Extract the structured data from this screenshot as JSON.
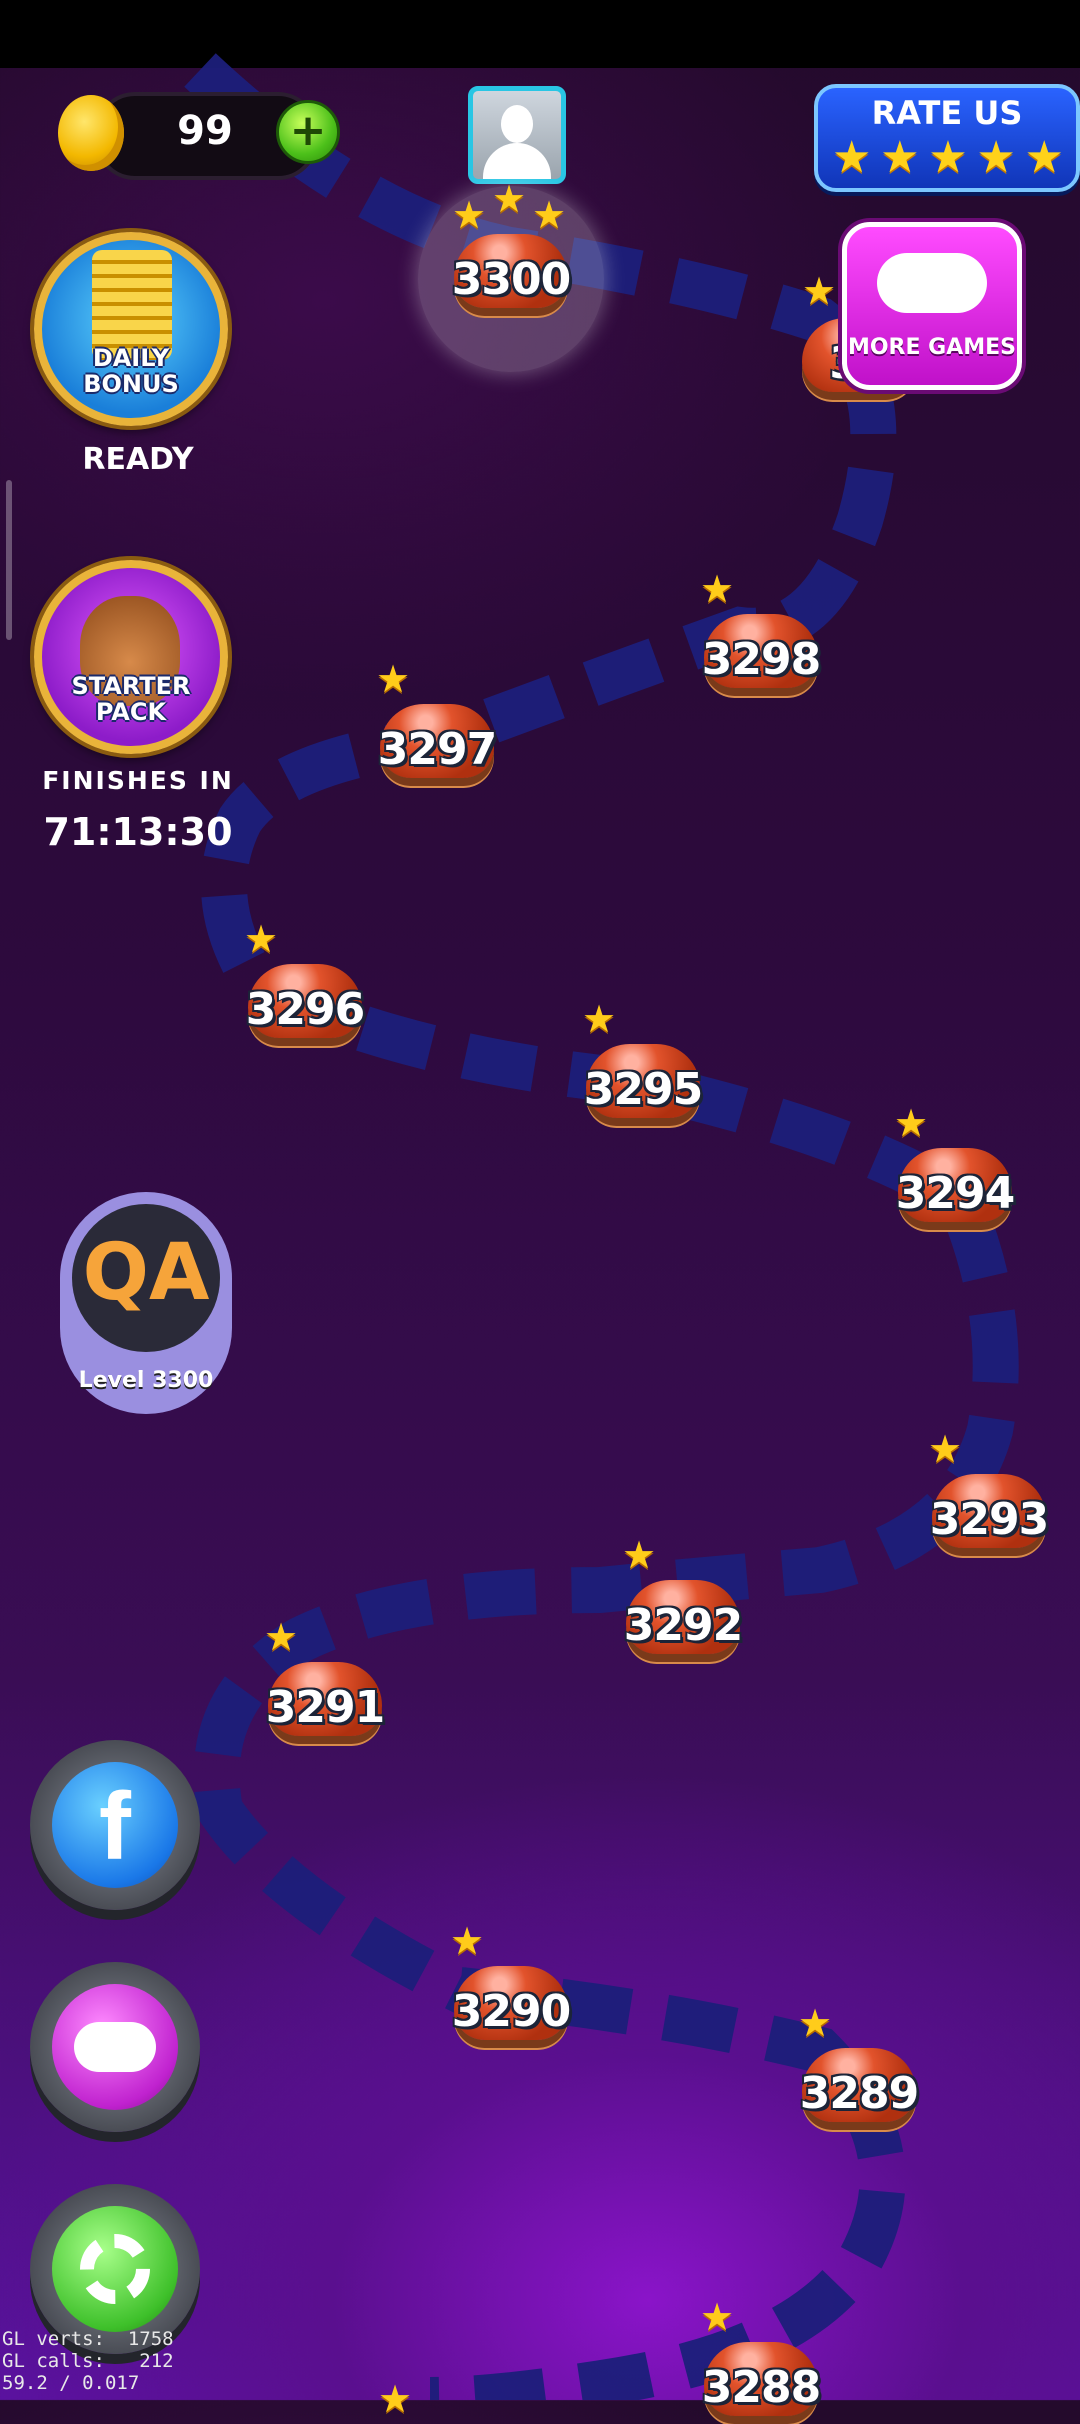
{
  "header": {
    "coins": "99",
    "coin_plus": "+",
    "rate_us_label": "RATE US",
    "rate_us_stars": 5
  },
  "left_panel": {
    "daily_bonus_label_1": "DAILY",
    "daily_bonus_label_2": "BONUS",
    "daily_bonus_status": "READY",
    "starter_pack_label_1": "STARTER",
    "starter_pack_label_2": "PACK",
    "starter_pack_caption": "FINISHES IN",
    "starter_pack_timer": "71:13:30"
  },
  "more_games": {
    "label": "MORE GAMES"
  },
  "qa_badge": {
    "text": "QA",
    "level_label": "Level 3300"
  },
  "levels": [
    {
      "number": "3300",
      "stars": 3,
      "current": true
    },
    {
      "number": "3299",
      "visible_text": "32",
      "stars": 1
    },
    {
      "number": "3298",
      "stars": 1
    },
    {
      "number": "3297",
      "stars": 1
    },
    {
      "number": "3296",
      "stars": 1
    },
    {
      "number": "3295",
      "stars": 1
    },
    {
      "number": "3294",
      "stars": 1
    },
    {
      "number": "3293",
      "stars": 1
    },
    {
      "number": "3292",
      "stars": 1
    },
    {
      "number": "3291",
      "stars": 1
    },
    {
      "number": "3290",
      "stars": 1
    },
    {
      "number": "3289",
      "stars": 1
    },
    {
      "number": "3288",
      "stars": 1
    }
  ],
  "bottom_buttons": {
    "facebook_letter": "f",
    "icons": [
      "facebook-icon",
      "gamepad-icon",
      "settings-gear-icon"
    ]
  },
  "debug": {
    "line1": "GL verts:  1758",
    "line2": "GL calls:   212",
    "line3": "59.2 / 0.017"
  },
  "colors": {
    "path": "#1c1f7a",
    "level_dome": "#e2532c",
    "star": "#ffcc1a",
    "rate_us_bg": "#1f4be0",
    "more_games_bg": "#e02ee8",
    "qa_bg": "#9a8fe0",
    "qa_text": "#f6a43a"
  }
}
